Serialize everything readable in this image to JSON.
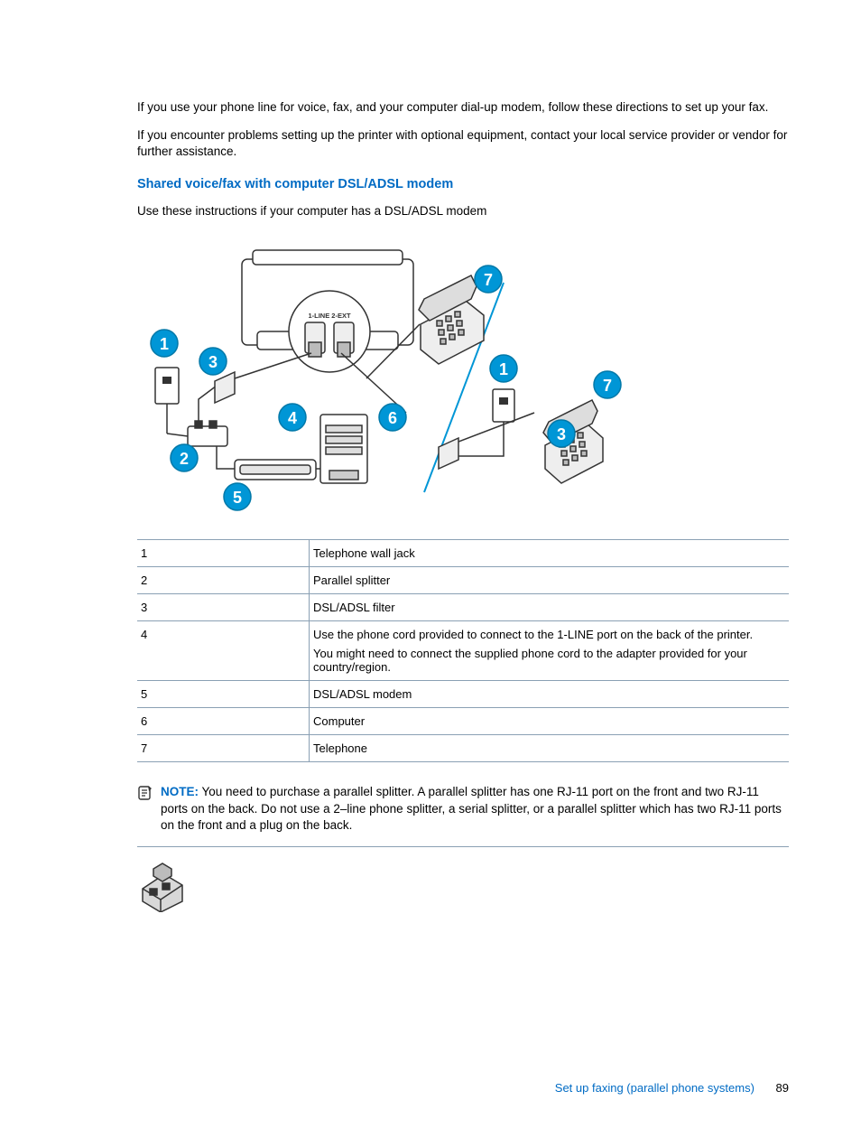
{
  "body": {
    "p1": "If you use your phone line for voice, fax, and your computer dial-up modem, follow these directions to set up your fax.",
    "p2": "If you encounter problems setting up the printer with optional equipment, contact your local service provider or vendor for further assistance."
  },
  "heading": "Shared voice/fax with computer DSL/ADSL modem",
  "subpara": "Use these instructions if your computer has a DSL/ADSL modem",
  "diagram": {
    "port_labels": "1-LINE  2-EXT"
  },
  "table": {
    "rows": [
      {
        "num": "1",
        "desc": "Telephone wall jack"
      },
      {
        "num": "2",
        "desc": "Parallel splitter"
      },
      {
        "num": "3",
        "desc": "DSL/ADSL filter"
      },
      {
        "num": "4",
        "desc": "Use the phone cord provided to connect to the 1-LINE port on the back of the printer.",
        "desc2": "You might need to connect the supplied phone cord to the adapter provided for your country/region."
      },
      {
        "num": "5",
        "desc": "DSL/ADSL modem"
      },
      {
        "num": "6",
        "desc": "Computer"
      },
      {
        "num": "7",
        "desc": "Telephone"
      }
    ]
  },
  "note": {
    "label": "NOTE:",
    "text": "You need to purchase a parallel splitter. A parallel splitter has one RJ-11 port on the front and two RJ-11 ports on the back. Do not use a 2–line phone splitter, a serial splitter, or a parallel splitter which has two RJ-11 ports on the front and a plug on the back."
  },
  "footer": {
    "section": "Set up faxing (parallel phone systems)",
    "page": "89"
  }
}
